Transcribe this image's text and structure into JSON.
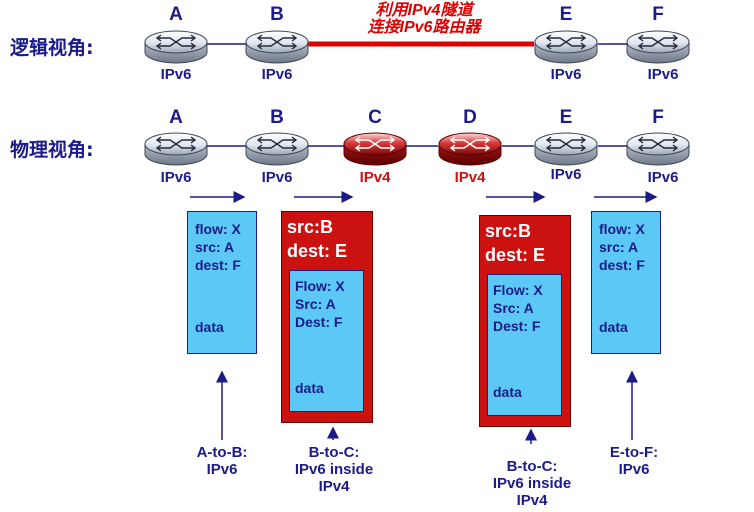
{
  "logical_view": {
    "label": "逻辑视角:",
    "routers": [
      {
        "letter": "A",
        "protocol": "IPv6"
      },
      {
        "letter": "B",
        "protocol": "IPv6"
      },
      {
        "letter": "E",
        "protocol": "IPv6"
      },
      {
        "letter": "F",
        "protocol": "IPv6"
      }
    ],
    "tunnel_note": [
      "利用IPv4隧道",
      "连接IPv6路由器"
    ]
  },
  "physical_view": {
    "label": "物理视角:",
    "routers": [
      {
        "letter": "A",
        "protocol": "IPv6"
      },
      {
        "letter": "B",
        "protocol": "IPv6"
      },
      {
        "letter": "C",
        "protocol": "IPv4"
      },
      {
        "letter": "D",
        "protocol": "IPv4"
      },
      {
        "letter": "E",
        "protocol": "IPv6"
      },
      {
        "letter": "F",
        "protocol": "IPv6"
      }
    ]
  },
  "packets": {
    "a_to_b": {
      "flow": "flow: X",
      "src": "src: A",
      "dest": "dest: F",
      "data": "data",
      "caption": [
        "A-to-B:",
        "IPv6"
      ]
    },
    "b_to_c": {
      "outer_src": "src:B",
      "outer_dest": "dest: E",
      "flow": "Flow: X",
      "src": "Src: A",
      "dest": "Dest: F",
      "data": "data",
      "caption": [
        "B-to-C:",
        "IPv6 inside",
        "IPv4"
      ]
    },
    "d_to_e": {
      "outer_src": "src:B",
      "outer_dest": "dest: E",
      "flow": "Flow: X",
      "src": "Src: A",
      "dest": "Dest: F",
      "data": "data",
      "caption": [
        "B-to-C:",
        "IPv6 inside",
        "IPv4"
      ]
    },
    "e_to_f": {
      "flow": "flow: X",
      "src": "src: A",
      "dest": "dest: F",
      "data": "data",
      "caption": [
        "E-to-F:",
        "IPv6"
      ]
    }
  },
  "colors": {
    "ipv6_router": "#e8eef6",
    "ipv4_router": "#c81e1e",
    "tunnel": "#dd0000",
    "link": "#1b1b8a",
    "inner_packet": "#5bc8f5",
    "outer_packet": "#cc1111"
  }
}
